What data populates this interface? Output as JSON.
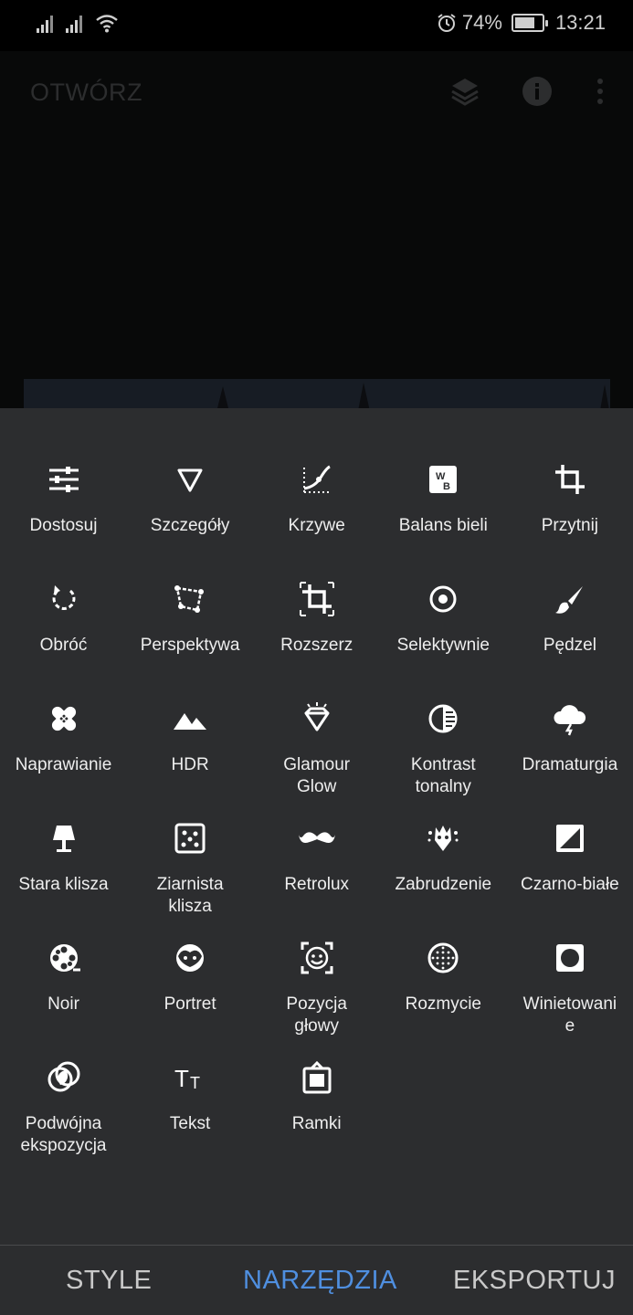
{
  "status_bar": {
    "battery": "74%",
    "time": "13:21",
    "battery_level": 0.74
  },
  "header": {
    "open_label": "OTWÓRZ",
    "icons": [
      "layers-stack-icon",
      "info-icon",
      "more-vert-icon"
    ]
  },
  "tools": [
    {
      "label": "Dostosuj",
      "icon": "sliders-icon"
    },
    {
      "label": "Szczegóły",
      "icon": "triangle-icon"
    },
    {
      "label": "Krzywe",
      "icon": "curves-icon"
    },
    {
      "label": "Balans bieli",
      "icon": "white-balance-icon"
    },
    {
      "label": "Przytnij",
      "icon": "crop-icon"
    },
    {
      "label": "Obróć",
      "icon": "rotate-icon"
    },
    {
      "label": "Perspektywa",
      "icon": "perspective-icon"
    },
    {
      "label": "Rozszerz",
      "icon": "expand-icon"
    },
    {
      "label": "Selektywnie",
      "icon": "selective-icon"
    },
    {
      "label": "Pędzel",
      "icon": "brush-icon"
    },
    {
      "label": "Naprawianie",
      "icon": "healing-icon"
    },
    {
      "label": "HDR",
      "icon": "mountains-icon"
    },
    {
      "label": "Glamour\nGlow",
      "icon": "diamond-icon"
    },
    {
      "label": "Kontrast\ntonalny",
      "icon": "tonal-contrast-icon"
    },
    {
      "label": "Dramaturgia",
      "icon": "storm-cloud-icon"
    },
    {
      "label": "Stara klisza",
      "icon": "lamp-icon"
    },
    {
      "label": "Ziarnista\nklisza",
      "icon": "grain-icon"
    },
    {
      "label": "Retrolux",
      "icon": "mustache-icon"
    },
    {
      "label": "Zabrudzenie",
      "icon": "grunge-icon"
    },
    {
      "label": "Czarno-białe",
      "icon": "black-white-icon"
    },
    {
      "label": "Noir",
      "icon": "film-reel-icon"
    },
    {
      "label": "Portret",
      "icon": "face-icon"
    },
    {
      "label": "Pozycja\ngłowy",
      "icon": "head-pose-icon"
    },
    {
      "label": "Rozmycie",
      "icon": "blur-icon"
    },
    {
      "label": "Winietowani\ne",
      "icon": "vignette-icon"
    },
    {
      "label": "Podwójna\nekspozycja",
      "icon": "double-exposure-icon"
    },
    {
      "label": "Tekst",
      "icon": "text-icon"
    },
    {
      "label": "Ramki",
      "icon": "frames-icon"
    }
  ],
  "nav": {
    "tabs": [
      {
        "label": "STYLE",
        "active": false
      },
      {
        "label": "NARZĘDZIA",
        "active": true
      },
      {
        "label": "EKSPORTUJ",
        "active": false
      }
    ],
    "active_color": "#4f8fe0",
    "inactive_color": "#c9c9c9"
  }
}
